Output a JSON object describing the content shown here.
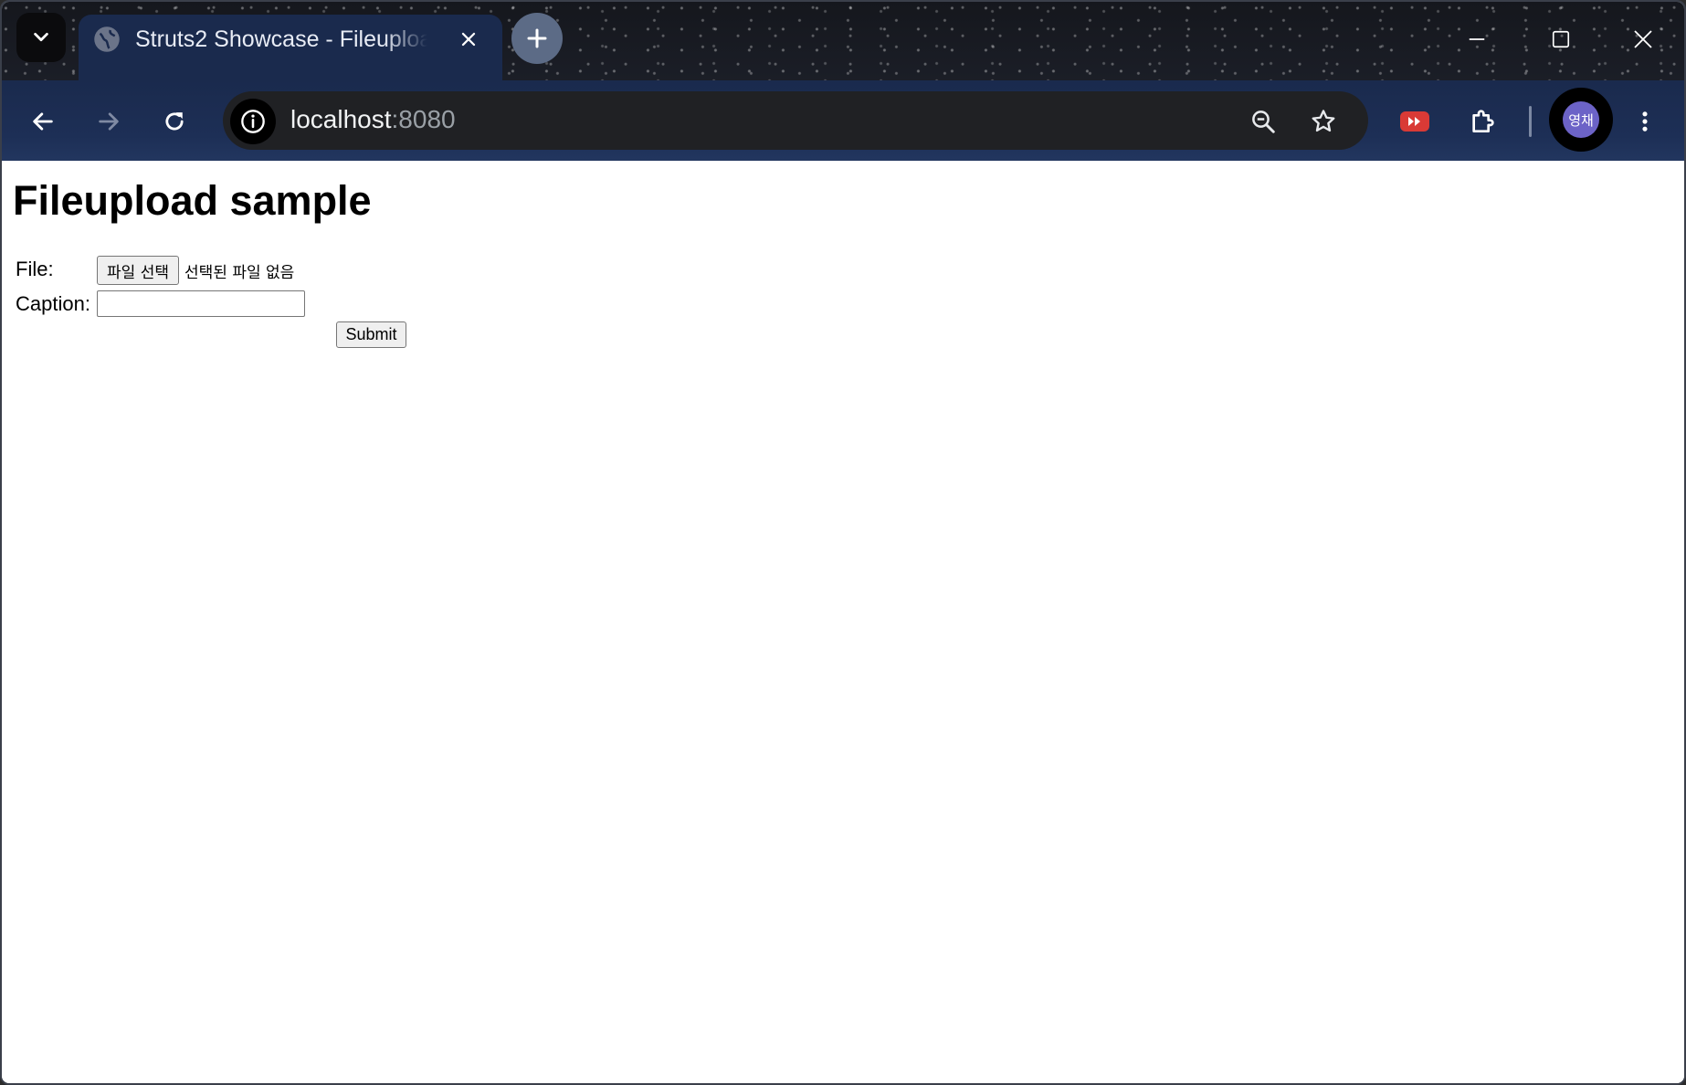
{
  "browser": {
    "tab": {
      "title": "Struts2 Showcase - Fileupload"
    },
    "address_bar": {
      "host": "localhost",
      "port": ":8080"
    },
    "profile": {
      "avatar_text": "영채",
      "avatar_color": "#6c63c7"
    },
    "icons": {
      "tab_search": "chevron-down-icon",
      "favicon": "globe-icon",
      "tab_close": "close-icon",
      "new_tab": "plus-icon",
      "back": "arrow-left-icon",
      "forward": "arrow-right-icon",
      "reload": "reload-icon",
      "site_info": "info-icon",
      "zoom": "zoom-out-icon",
      "bookmark": "star-icon",
      "extension_video": "video-extension-icon",
      "extensions": "puzzle-icon",
      "menu": "more-vert-icon"
    },
    "colors": {
      "tab_active": "#1a2a4d",
      "toolbar": "#1d2f56",
      "omnibox": "#202124"
    }
  },
  "page": {
    "heading": "Fileupload sample",
    "form": {
      "file_label": "File:",
      "file_button_label": "파일 선택",
      "file_status": "선택된 파일 없음",
      "caption_label": "Caption:",
      "caption_value": "",
      "submit_label": "Submit"
    }
  }
}
